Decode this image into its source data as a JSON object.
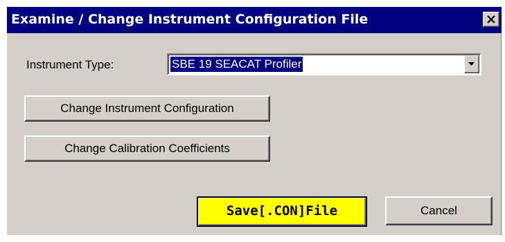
{
  "window": {
    "title": "Examine / Change Instrument Configuration File",
    "close_icon": "close-x-icon"
  },
  "instrument_type": {
    "label": "Instrument Type:",
    "selected": "SBE 19 SEACAT Profiler",
    "dropdown_icon": "chevron-down-icon"
  },
  "buttons": {
    "change_config": "Change Instrument Configuration",
    "change_calib": "Change Calibration Coefficients",
    "save": "Save[.CON]File",
    "cancel": "Cancel"
  },
  "colors": {
    "titlebar": "#000080",
    "dialog_face": "#d4d0c8",
    "save_highlight": "#ffff00",
    "selection": "#000080"
  }
}
